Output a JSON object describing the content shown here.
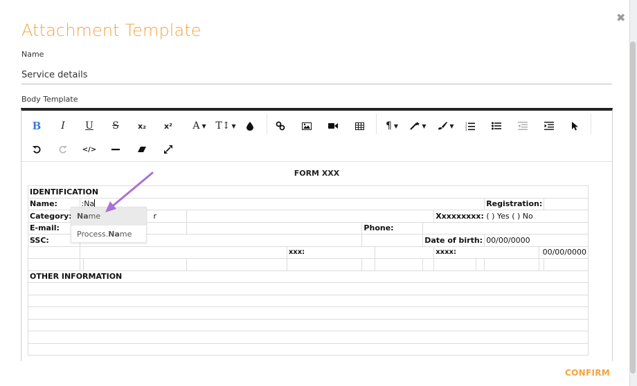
{
  "modal": {
    "title": "Attachment Template",
    "close_icon": "close-icon"
  },
  "name_field": {
    "label": "Name",
    "value": "Service details"
  },
  "body_template": {
    "label": "Body Template"
  },
  "toolbar": {
    "row1": [
      "bold-icon",
      "italic-icon",
      "underline-icon",
      "strikethrough-icon",
      "subscript-icon",
      "superscript-icon",
      "font-family-icon",
      "font-size-icon",
      "color-icon",
      "link-icon",
      "image-icon",
      "video-icon",
      "table-icon",
      "paragraph-icon",
      "magic-icon",
      "brush-icon",
      "ordered-list-icon",
      "unordered-list-icon",
      "outdent-icon",
      "indent-icon",
      "select-icon"
    ],
    "row2": [
      "undo-icon",
      "redo-icon",
      "code-view-icon",
      "horizontal-rule-icon",
      "eraser-icon",
      "fullscreen-icon"
    ],
    "bold": "B",
    "italic": "I",
    "underline": "U",
    "strike": "S",
    "sub": "x₂",
    "sup": "x²",
    "font": "A",
    "size": "T↕",
    "paragraph": "¶",
    "code": "</>"
  },
  "document": {
    "title": "FORM XXX",
    "identification": "IDENTIFICATION",
    "name_label": "Name:",
    "name_typed": ":Na",
    "registration_label": "Registration:",
    "category_label": "Category: (",
    "category_suffix": "r",
    "xxxx_label": "Xxxxxxxxx:",
    "yes_no": "( ) Yes ( ) No",
    "email_label": "E-mail:",
    "phone_label": "Phone:",
    "ssc_label": "SSC:",
    "dob_label": "Date of birth:",
    "dob_value": "00/00/0000",
    "xxx_label": "xxx:",
    "xxxx2_label": "xxxx:",
    "date_value": "00/00/0000",
    "other_info": "OTHER INFORMATION"
  },
  "autocomplete": {
    "items": [
      {
        "prefix": "Na",
        "rest": "me"
      },
      {
        "prefix_plain": "Process.",
        "prefix": "Na",
        "rest": "me"
      }
    ]
  },
  "footer": {
    "confirm": "CONFIRM"
  },
  "colors": {
    "accent": "#f5a33d",
    "arrow": "#a970d6"
  }
}
